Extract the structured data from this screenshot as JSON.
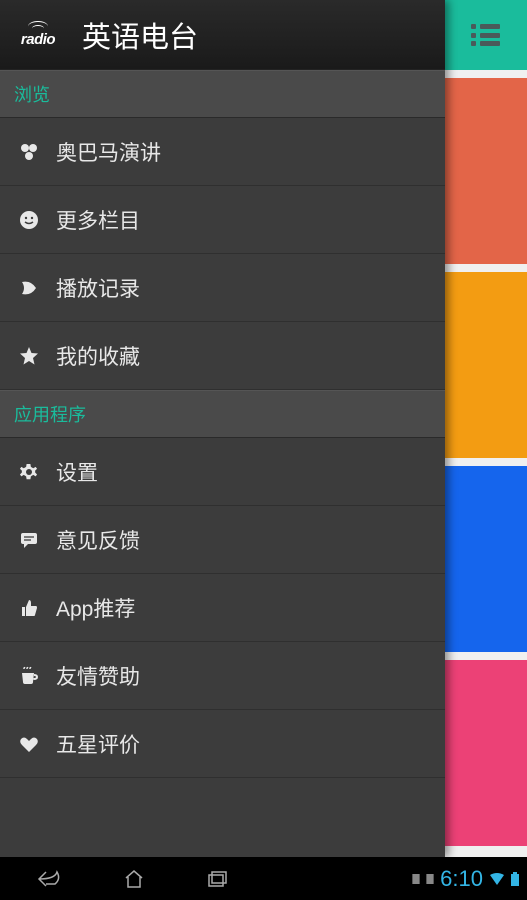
{
  "header": {
    "logo_text": "radio",
    "title": "英语电台"
  },
  "sections": {
    "browse": {
      "header": "浏览",
      "items": [
        {
          "icon": "circles",
          "label": "奥巴马演讲"
        },
        {
          "icon": "smile",
          "label": "更多栏目"
        },
        {
          "icon": "leaf",
          "label": "播放记录"
        },
        {
          "icon": "star",
          "label": "我的收藏"
        }
      ]
    },
    "apps": {
      "header": "应用程序",
      "items": [
        {
          "icon": "gear",
          "label": "设置"
        },
        {
          "icon": "chat",
          "label": "意见反馈"
        },
        {
          "icon": "thumb",
          "label": "App推荐"
        },
        {
          "icon": "cup",
          "label": "友情赞助"
        },
        {
          "icon": "heart",
          "label": "五星评价"
        }
      ]
    }
  },
  "right_tiles": {
    "colors": [
      "#e36548",
      "#f39c12",
      "#1565ed",
      "#ec4176"
    ]
  },
  "nav": {
    "time": "6:10"
  }
}
